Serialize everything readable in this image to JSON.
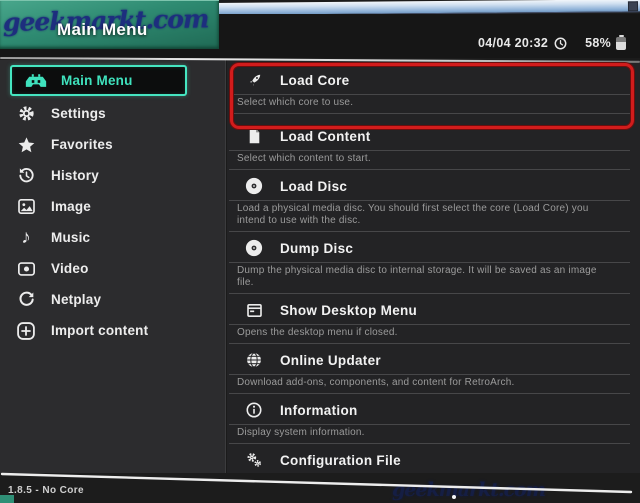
{
  "watermark": {
    "top_text": "geekmarkt.com",
    "bottom_text": "geekmarkt.com"
  },
  "header": {
    "title": "Main Menu",
    "datetime": "04/04 20:32",
    "battery_percent": "58%"
  },
  "sidebar": {
    "items": [
      {
        "label": "Main Menu",
        "icon": "retroarch-icon",
        "selected": true
      },
      {
        "label": "Settings",
        "icon": "gear-icon",
        "selected": false
      },
      {
        "label": "Favorites",
        "icon": "star-icon",
        "selected": false
      },
      {
        "label": "History",
        "icon": "history-icon",
        "selected": false
      },
      {
        "label": "Image",
        "icon": "image-icon",
        "selected": false
      },
      {
        "label": "Music",
        "icon": "music-icon",
        "selected": false
      },
      {
        "label": "Video",
        "icon": "video-icon",
        "selected": false
      },
      {
        "label": "Netplay",
        "icon": "netplay-icon",
        "selected": false
      },
      {
        "label": "Import content",
        "icon": "import-icon",
        "selected": false
      }
    ]
  },
  "content": {
    "items": [
      {
        "label": "Load Core",
        "sublabel": "Select which core to use.",
        "icon": "rocket-icon",
        "highlighted": true
      },
      {
        "label": "Load Content",
        "sublabel": "Select which content to start.",
        "icon": "file-icon",
        "highlighted": false
      },
      {
        "label": "Load Disc",
        "sublabel": "Load a physical media disc. You should first select the core (Load Core)  you intend to use with the disc.",
        "icon": "disc-icon",
        "highlighted": false
      },
      {
        "label": "Dump Disc",
        "sublabel": "Dump the physical media disc to internal storage. It will be saved as an image file.",
        "icon": "disc-icon",
        "highlighted": false
      },
      {
        "label": "Show Desktop Menu",
        "sublabel": "Opens the desktop menu if closed.",
        "icon": "window-icon",
        "highlighted": false
      },
      {
        "label": "Online Updater",
        "sublabel": "Download add-ons, components, and content for RetroArch.",
        "icon": "globe-icon",
        "highlighted": false
      },
      {
        "label": "Information",
        "sublabel": "Display system information.",
        "icon": "info-icon",
        "highlighted": false
      },
      {
        "label": "Configuration File",
        "sublabel": "",
        "icon": "gears-icon",
        "highlighted": false
      }
    ]
  },
  "footer": {
    "status": "1.8.5 - No Core"
  },
  "colors": {
    "accent_teal": "#3fe2bd",
    "highlight_red": "#d21c1c",
    "banner_green": "#2e8a71"
  }
}
